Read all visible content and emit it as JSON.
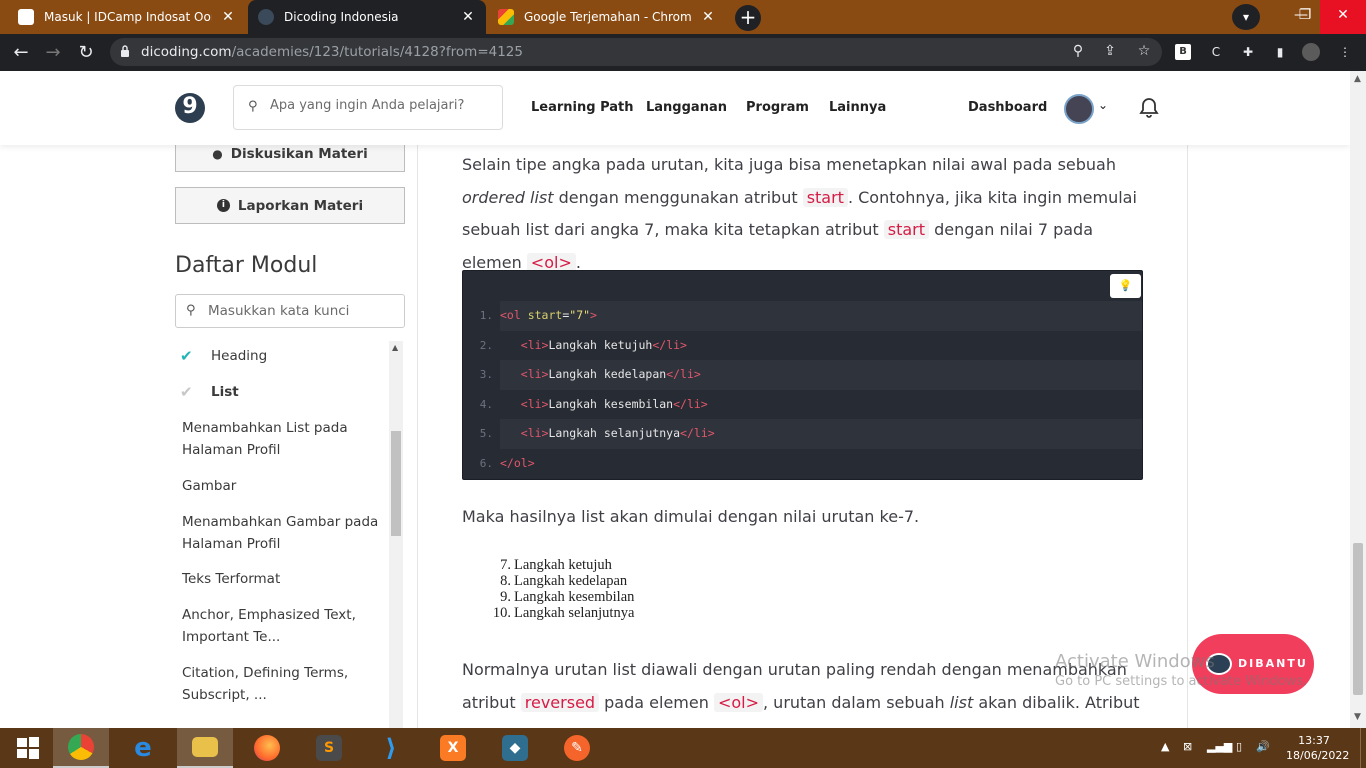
{
  "browser": {
    "tabs": [
      {
        "title": "Masuk | IDCamp Indosat Ooredoo",
        "active": false
      },
      {
        "title": "Dicoding Indonesia",
        "active": true
      },
      {
        "title": "Google Terjemahan - Chrome Web Store",
        "active": false
      }
    ],
    "close_glyph": "✕",
    "new_tab_glyph": "+",
    "url_host": "dicoding.com",
    "url_path": "/academies/123/tutorials/4128?from=4125"
  },
  "header": {
    "logo_text": "9",
    "search_placeholder": "Apa yang ingin Anda pelajari?",
    "nav": [
      "Learning Path",
      "Langganan",
      "Program",
      "Lainnya"
    ],
    "dashboard": "Dashboard"
  },
  "sidebar": {
    "discuss_button": "Diskusikan Materi",
    "report_button": "Laporkan Materi",
    "module_title": "Daftar Modul",
    "module_search_placeholder": "Masukkan kata kunci",
    "modules": [
      {
        "label": "Heading",
        "done": true
      },
      {
        "label": "List",
        "current": true
      },
      {
        "label": "Menambahkan List pada Halaman Profil"
      },
      {
        "label": "Gambar"
      },
      {
        "label": "Menambahkan Gambar pada Halaman Profil"
      },
      {
        "label": "Teks Terformat"
      },
      {
        "label": "Anchor, Emphasized Text, Important Te..."
      },
      {
        "label": "Citation, Defining Terms, Subscript, ..."
      }
    ]
  },
  "content": {
    "p1": {
      "a": "Selain tipe angka pada urutan, kita juga bisa menetapkan nilai awal pada sebuah ",
      "em": "ordered list",
      "b": " dengan menggunakan atribut ",
      "code1": "start",
      "c": ". Contohnya, jika kita ingin memulai sebuah list dari angka 7, maka kita tetapkan atribut ",
      "code2": "start",
      "d": " dengan nilai 7 pada elemen ",
      "code3": "<ol>",
      "e": "."
    },
    "code_lines": [
      {
        "no": "1.",
        "indent": "",
        "open": "<ol",
        "attr": " start",
        "eq": "=",
        "val": "\"7\"",
        "close": ">",
        "text": "",
        "end": ""
      },
      {
        "no": "2.",
        "indent": "   ",
        "open": "<li>",
        "attr": "",
        "eq": "",
        "val": "",
        "close": "",
        "text": "Langkah ketujuh",
        "end": "</li>"
      },
      {
        "no": "3.",
        "indent": "   ",
        "open": "<li>",
        "attr": "",
        "eq": "",
        "val": "",
        "close": "",
        "text": "Langkah kedelapan",
        "end": "</li>"
      },
      {
        "no": "4.",
        "indent": "   ",
        "open": "<li>",
        "attr": "",
        "eq": "",
        "val": "",
        "close": "",
        "text": "Langkah kesembilan",
        "end": "</li>"
      },
      {
        "no": "5.",
        "indent": "   ",
        "open": "<li>",
        "attr": "",
        "eq": "",
        "val": "",
        "close": "",
        "text": "Langkah selanjutnya",
        "end": "</li>"
      },
      {
        "no": "6.",
        "indent": "",
        "open": "</ol>",
        "attr": "",
        "eq": "",
        "val": "",
        "close": "",
        "text": "",
        "end": ""
      }
    ],
    "p2": "Maka hasilnya list akan dimulai dengan nilai urutan ke-7.",
    "result_list": [
      {
        "n": "7.",
        "t": "Langkah ketujuh"
      },
      {
        "n": "8.",
        "t": "Langkah kedelapan"
      },
      {
        "n": "9.",
        "t": "Langkah kesembilan"
      },
      {
        "n": "10.",
        "t": "Langkah selanjutnya"
      }
    ],
    "p3": {
      "a": "Normalnya urutan list diawali dengan urutan paling rendah dengan menambahkan atribut ",
      "code1": "reversed",
      "b": " pada elemen ",
      "code2": "<ol>",
      "c": ", urutan dalam sebuah ",
      "em": "list",
      "d": " akan dibalik. Atribut ini"
    }
  },
  "dibantu": "DIBANTU",
  "watermark": {
    "line1": "Activate Windows",
    "line2": "Go to PC settings to activate Windows."
  },
  "taskbar": {
    "time": "13:37",
    "date": "18/06/2022"
  },
  "colors": {
    "code_bg": "#272b33",
    "inline_code": "#d61b45",
    "dibantu": "#f03e5c",
    "taskbar": "#5a3716",
    "tabstrip": "#8a4b12"
  }
}
